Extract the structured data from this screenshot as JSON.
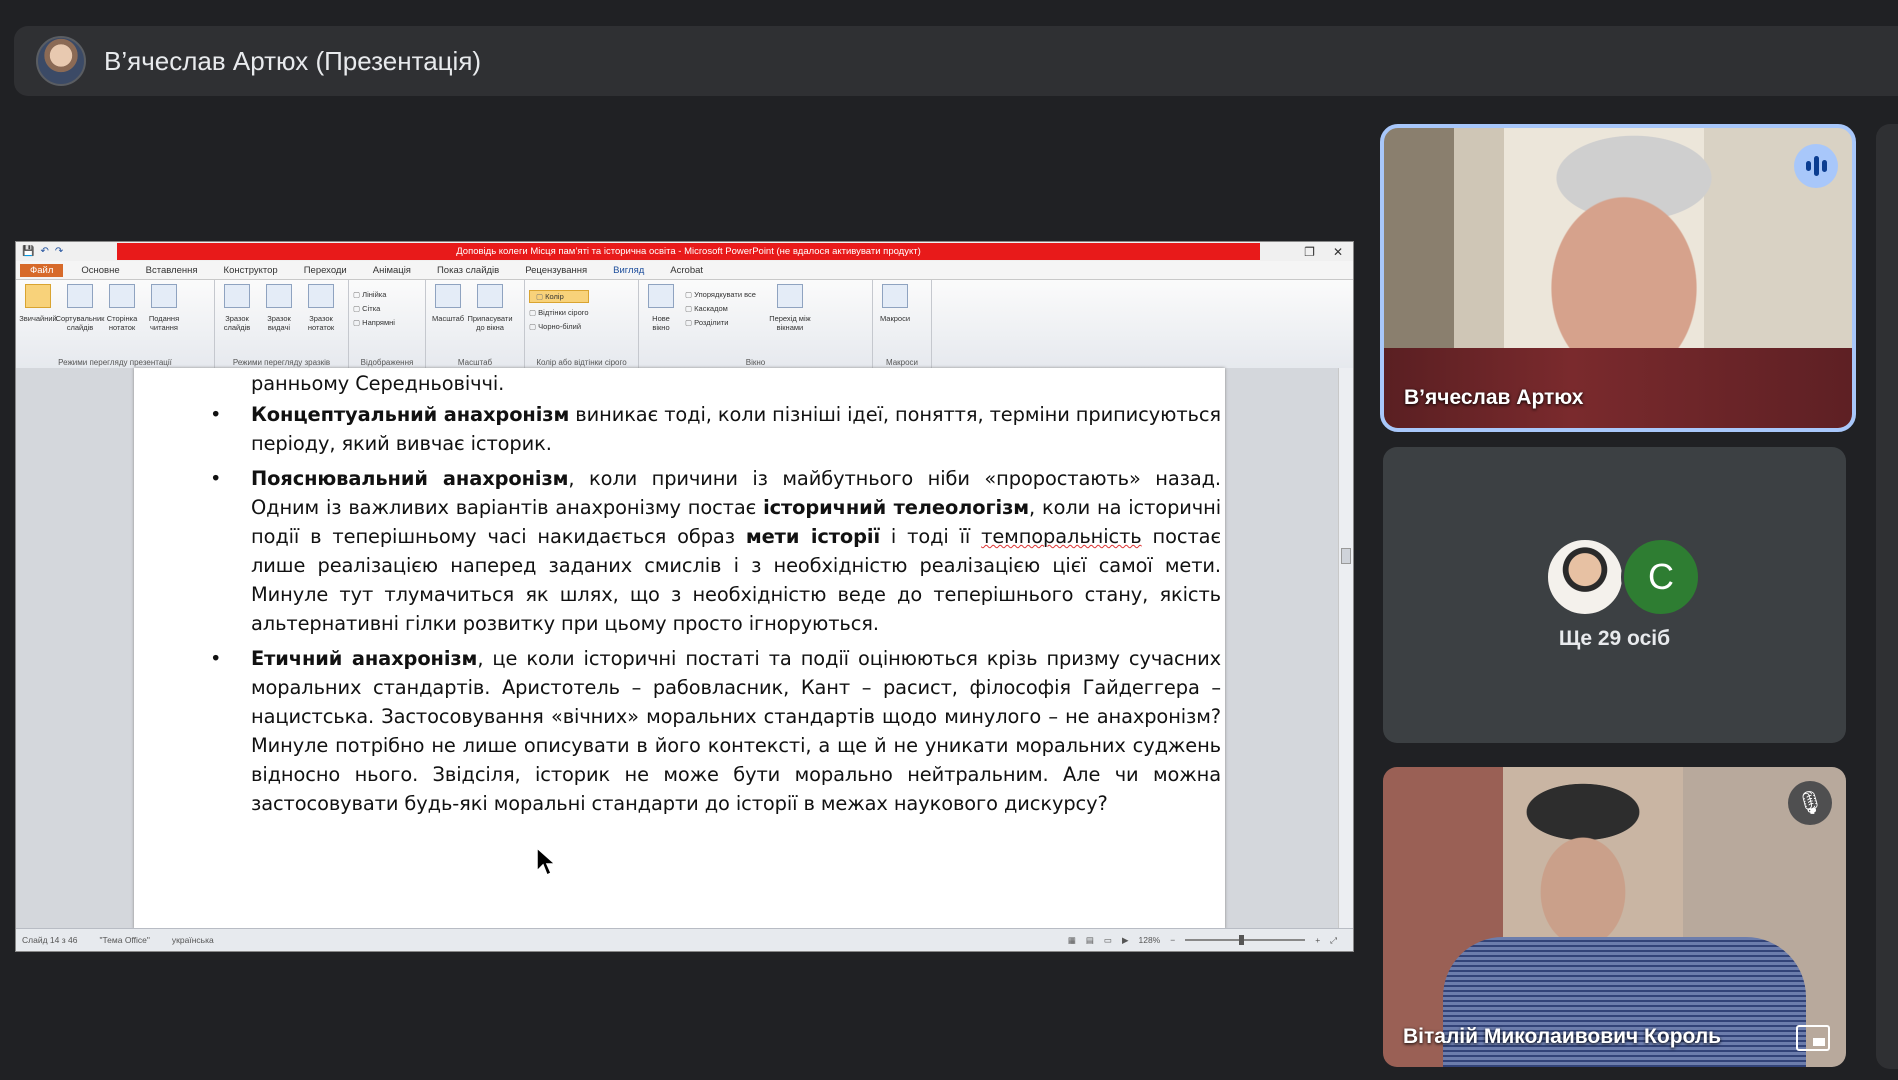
{
  "header": {
    "title": "В’ячеслав Артюх (Презентація)"
  },
  "ppt": {
    "window_title": "Доповідь колеги Місця пам’яті та історична освіта - Microsoft PowerPoint (не вдалося активувати продукт)",
    "quick_access": [
      "💾",
      "↶",
      "↷"
    ],
    "tabs": [
      "Файл",
      "Основне",
      "Вставлення",
      "Конструктор",
      "Переходи",
      "Анімація",
      "Показ слайдів",
      "Рецензування",
      "Вигляд",
      "Acrobat"
    ],
    "active_tab": "Вигляд",
    "ribbon": {
      "views": [
        "Звичайний",
        "Сортувальник слайдів",
        "Сторінка нотаток",
        "Подання читання"
      ],
      "views_label": "Режими перегляду презентації",
      "master": [
        "Зразок слайдів",
        "Зразок видачі",
        "Зразок нотаток"
      ],
      "master_label": "Режими перегляду зразків",
      "show": [
        "Лінійка",
        "Сітка",
        "Напрямні"
      ],
      "show_label": "Відображення",
      "zoom": [
        "Масштаб",
        "Припасувати до вікна"
      ],
      "zoom_label": "Масштаб",
      "color": [
        "Колір",
        "Відтінки сірого",
        "Чорно-білий"
      ],
      "color_label": "Колір або відтінки сірого",
      "window": [
        "Нове вікно",
        "Упорядкувати все",
        "Каскадом",
        "Розділити",
        "Перехід між вікнами"
      ],
      "window_label": "Вікно",
      "macros": "Макроси",
      "macros_label": "Макроси"
    },
    "doc": {
      "first_line": "ранньому Середньовіччі.",
      "bullets": [
        {
          "bold": "Концептуальний анахронізм",
          "text": " виникає тоді, коли пізніші ідеї, поняття, терміни приписуються періоду, який вивчає історик."
        },
        {
          "bold": "Пояснювальний анахронізм",
          "text1": ", коли причини із майбутнього ніби «проростають» назад. Одним із важливих варіантів анахронізму постає ",
          "bold2": "історичний телеологізм",
          "text2": ", коли на історичні події в теперішньому часі накидається образ ",
          "bold3": "мети історії",
          "text3": " і тоді її ",
          "squig": "темпоральність",
          "text4": " постає лише реалізацією наперед заданих смислів і з необхідністю реалізацією цієї самої мети. Минуле тут тлумачиться як шлях, що з необхідністю веде до теперішнього стану, якість альтернативні гілки розвитку при цьому просто ігноруються."
        },
        {
          "bold": "Етичний анахронізм",
          "text": ", це коли історичні постаті та події оцінюються крізь призму сучасних моральних стандартів. Аристотель – рабовласник, Кант – расист, філософія Гайдеггера – нацистська. Застосовування «вічних» моральних стандартів щодо минулого – не анахронізм? Минуле потрібно не лише описувати в його контексті, а ще й не уникати моральних суджень відносно нього. Звідсіля, історик не може бути морально нейтральним. Але чи  можна застосовувати будь-які моральні стандарти до історії в межах наукового дискурсу?"
        }
      ]
    },
    "status": {
      "slide": "Слайд 14 з 46",
      "theme": "\"Тема Office\"",
      "lang": "українська",
      "zoom": "128%"
    }
  },
  "participants": {
    "presenter": {
      "name": "В’ячеслав Артюх"
    },
    "group": {
      "more_label": "Ще 29 осіб",
      "initial": "С"
    },
    "third": {
      "name": "Віталій Миколаивович Король"
    }
  },
  "colors": {
    "bg": "#202124",
    "speaking_border": "#a8c7fa",
    "ppt_title_red": "#e81a1a"
  }
}
